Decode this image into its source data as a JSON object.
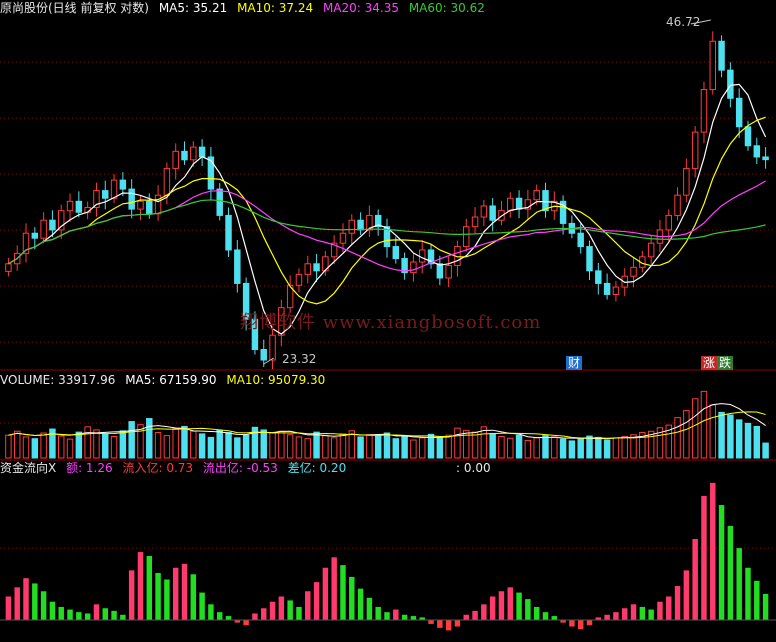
{
  "price_header": {
    "name": "原尚股份(日线 前复权 对数)",
    "ma5": "MA5: 35.21",
    "ma10": "MA10: 37.24",
    "ma20": "MA20: 34.35",
    "ma60": "MA60: 30.62"
  },
  "volume_header": {
    "name": "VOLUME: 33917.96",
    "ma5": "MA5: 67159.90",
    "ma10": "MA10: 95079.30"
  },
  "fund_header": {
    "name": "资金流向X",
    "amount": "额: 1.26",
    "inflow": "流入亿: 0.73",
    "outflow": "流出亿: -0.53",
    "diff": "差亿: 0.20",
    "extra": ": 0.00"
  },
  "annotations": {
    "high_label": "46.72",
    "low_label": "23.32",
    "cai_marker": "财",
    "zhang_marker": "涨",
    "die_marker": "跌",
    "watermark": "翔博软件 www.xiangbosoft.com"
  },
  "colors": {
    "up": "#ff3b3b",
    "down": "#4ee0ee",
    "ma5": "#ffffff",
    "ma10": "#ffff00",
    "ma20": "#ff40ff",
    "ma60": "#33cc33",
    "inflow": "#ff3b6e",
    "outflow_green": "#22dd22",
    "grid": "#8b0000"
  },
  "chart_data": [
    {
      "type": "candlestick",
      "title": "原尚股份(日线 前复权 对数)",
      "series": [
        {
          "name": "MA5",
          "values": [
            35.21
          ]
        },
        {
          "name": "MA10",
          "values": [
            37.24
          ]
        },
        {
          "name": "MA20",
          "values": [
            34.35
          ]
        },
        {
          "name": "MA60",
          "values": [
            30.62
          ]
        }
      ],
      "annotations": [
        {
          "text": "46.72",
          "meaning": "period high"
        },
        {
          "text": "23.32",
          "meaning": "period low"
        }
      ],
      "close": [
        28.6,
        29.2,
        30.4,
        30.1,
        31.2,
        30.6,
        31.8,
        32.4,
        31.7,
        32.0,
        33.1,
        32.6,
        33.8,
        33.2,
        31.9,
        32.4,
        31.6,
        32.8,
        34.6,
        35.8,
        35.2,
        36.1,
        35.4,
        33.2,
        31.5,
        29.4,
        27.5,
        25.6,
        24.1,
        23.6,
        24.8,
        26.2,
        27.4,
        28.0,
        28.6,
        28.2,
        29.0,
        29.8,
        30.4,
        31.2,
        30.6,
        31.5,
        30.8,
        29.6,
        28.9,
        28.1,
        28.7,
        29.4,
        28.6,
        27.8,
        28.5,
        29.6,
        30.8,
        31.4,
        32.1,
        31.2,
        31.8,
        32.6,
        31.9,
        32.5,
        33.1,
        31.8,
        32.4,
        31.0,
        30.4,
        29.6,
        28.2,
        27.5,
        26.9,
        27.3,
        27.9,
        28.4,
        29.0,
        29.8,
        30.6,
        31.5,
        32.8,
        34.6,
        37.2,
        40.5,
        44.6,
        42.1,
        39.8,
        37.6,
        36.2,
        35.4,
        35.21
      ],
      "ylim": [
        23.32,
        46.72
      ]
    },
    {
      "type": "bar",
      "title": "VOLUME",
      "series": [
        {
          "name": "VOLUME",
          "values": [
            33917.96
          ]
        },
        {
          "name": "MA5",
          "values": [
            67159.9
          ]
        },
        {
          "name": "MA10",
          "values": [
            95079.3
          ]
        }
      ],
      "values": [
        52,
        61,
        48,
        44,
        57,
        66,
        50,
        43,
        59,
        71,
        64,
        55,
        49,
        62,
        83,
        76,
        90,
        58,
        51,
        67,
        72,
        61,
        55,
        47,
        63,
        58,
        46,
        52,
        70,
        64,
        57,
        61,
        53,
        48,
        44,
        59,
        51,
        46,
        55,
        62,
        48,
        53,
        50,
        57,
        44,
        49,
        41,
        46,
        54,
        47,
        52,
        68,
        63,
        59,
        71,
        56,
        49,
        45,
        52,
        40,
        46,
        51,
        48,
        43,
        39,
        44,
        50,
        47,
        41,
        46,
        49,
        53,
        58,
        61,
        69,
        75,
        92,
        108,
        135,
        152,
        121,
        104,
        98,
        87,
        79,
        72,
        34
      ]
    },
    {
      "type": "bar",
      "title": "资金流向X",
      "series": [
        {
          "name": "额",
          "values": [
            1.26
          ]
        },
        {
          "name": "流入亿",
          "values": [
            0.73
          ]
        },
        {
          "name": "流出亿",
          "values": [
            -0.53
          ]
        },
        {
          "name": "差亿",
          "values": [
            0.2
          ]
        }
      ],
      "values": [
        0.18,
        0.25,
        0.32,
        0.28,
        0.22,
        0.14,
        0.1,
        0.08,
        0.06,
        0.05,
        0.12,
        0.09,
        0.07,
        0.04,
        0.38,
        0.52,
        0.49,
        0.36,
        0.31,
        0.4,
        0.43,
        0.35,
        0.21,
        0.12,
        0.06,
        0.03,
        -0.02,
        -0.04,
        0.05,
        0.09,
        0.14,
        0.18,
        0.15,
        0.1,
        0.22,
        0.29,
        0.4,
        0.48,
        0.42,
        0.33,
        0.24,
        0.17,
        0.1,
        0.06,
        0.08,
        0.04,
        0.03,
        0.02,
        -0.03,
        -0.06,
        -0.08,
        -0.05,
        0.04,
        0.07,
        0.12,
        0.18,
        0.22,
        0.25,
        0.21,
        0.16,
        0.1,
        0.06,
        0.03,
        -0.02,
        -0.05,
        -0.07,
        -0.04,
        0.02,
        0.04,
        0.06,
        0.09,
        0.12,
        0.1,
        0.08,
        0.14,
        0.18,
        0.26,
        0.38,
        0.62,
        0.95,
        1.05,
        0.88,
        0.72,
        0.55,
        0.4,
        0.3,
        0.2
      ]
    }
  ]
}
